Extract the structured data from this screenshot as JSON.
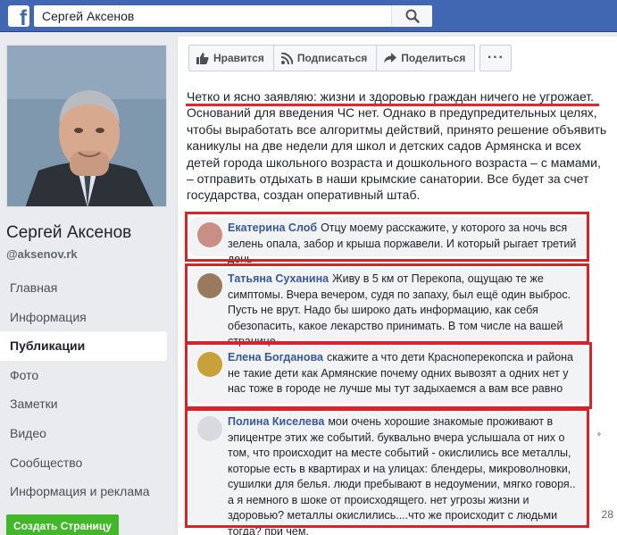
{
  "topbar": {
    "logo": "f",
    "search_value": "Сергей Аксенов",
    "search_icon": "search-icon"
  },
  "profile": {
    "name": "Сергей Аксенов",
    "handle": "@aksenov.rk"
  },
  "nav": {
    "items": [
      "Главная",
      "Информация",
      "Публикации",
      "Фото",
      "Заметки",
      "Видео",
      "Сообщество",
      "Информация и реклама"
    ],
    "active": "Публикации"
  },
  "create_page_label": "Создать Страницу",
  "actions": {
    "like": "Нравится",
    "subscribe": "Подписаться",
    "share": "Поделиться",
    "more": "···"
  },
  "post": {
    "text": "Четко и ясно заявляю: жизни и здоровью граждан ничего не угрожает. Оснований для введения ЧС нет. Однако в предупредительных целях, чтобы выработать все алгоритмы действий, принято решение объявить каникулы на две недели для школ и детских садов Армянска и всех детей города школьного возраста и дошкольного возраста – с мамами, – отправить отдыхать в наши крымские санатории. Все будет за счет государства, создан оперативный штаб."
  },
  "comments": [
    {
      "author": "Екатерина Слоб",
      "text": "Отцу моему расскажите, у которого за ночь вся зелень опала, забор и крыша поржавели. И который рыгает третий день"
    },
    {
      "author": "Татьяна Суханина",
      "text": "Живу в 5 км от Перекопа, ощущаю те же симптомы. Вчера вечером, судя по запаху, был ещё один выброс. Пусть не врут. Надо бы широко дать информацию, как себя обезопасить, какое лекарство принимать. В том числе на вашей странице."
    },
    {
      "author": "Елена Богданова",
      "text": "скажите а что дети Красноперекопска и района не такие дети как Армянские почему одних вывозят а одних нет у нас тоже в городе не лучше мы тут задыхаемся а вам все равно"
    },
    {
      "author": "Полина Киселева",
      "text": "мои очень хорошие знакомые проживают в эпицентре этих же событий. буквально вчера услышала от них о том, что происходит на месте событий - окислились все металлы, которые есть в квартирах и на улицах: блендеры, микроволновки, сушилки для белья. люди пребывают в недоумении, мягко говоря.. а я немного в шоке от происходящего. нет угрозы жизни и здоровью? металлы окислились....что же происходит с людьми тогда? при чем,"
    }
  ],
  "side_mark": "°",
  "page_count": "28",
  "colors": {
    "brand": "#4267b2",
    "highlight": "#d8232a",
    "link": "#385898",
    "create_button": "#42b72a"
  }
}
